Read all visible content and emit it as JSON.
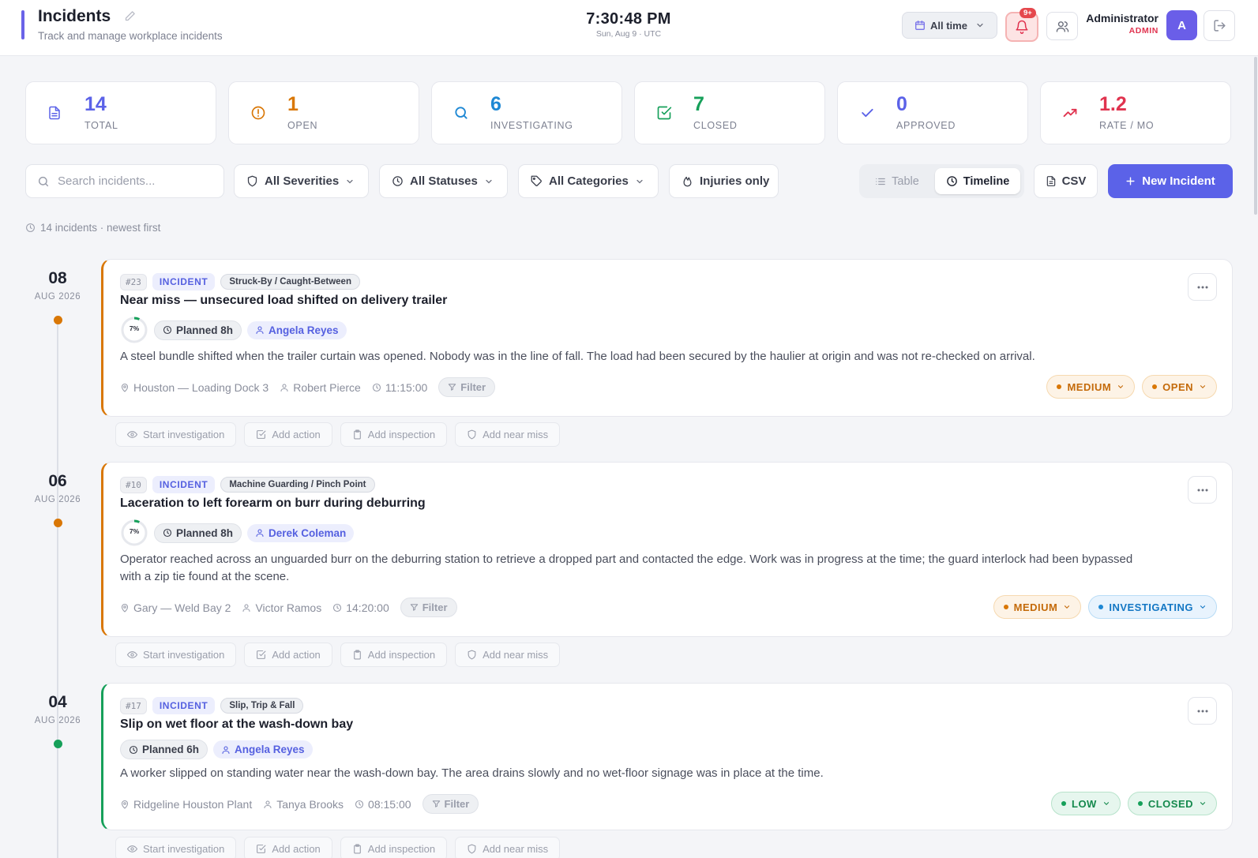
{
  "header": {
    "title": "Incidents",
    "subtitle": "Track and manage workplace incidents",
    "time": "7:30:48 PM",
    "date": "Sun, Aug 9 · UTC",
    "range_label": "All time",
    "notif_badge": "9+",
    "user_name": "Administrator",
    "user_role": "ADMIN",
    "avatar_letter": "A"
  },
  "stats": [
    {
      "value": "14",
      "label": "TOTAL",
      "color": "#5b62e8",
      "icon": "document-icon"
    },
    {
      "value": "1",
      "label": "OPEN",
      "color": "#d97706",
      "icon": "alert-circle-icon"
    },
    {
      "value": "6",
      "label": "INVESTIGATING",
      "color": "#1e88d4",
      "icon": "search-icon"
    },
    {
      "value": "7",
      "label": "CLOSED",
      "color": "#16a05a",
      "icon": "check-square-icon"
    },
    {
      "value": "0",
      "label": "APPROVED",
      "color": "#5b62e8",
      "icon": "check-icon"
    },
    {
      "value": "1.2",
      "label": "RATE / MO",
      "color": "#e0334f",
      "icon": "trending-up-icon"
    }
  ],
  "toolbar": {
    "search_placeholder": "Search incidents...",
    "severity": "All Severities",
    "status": "All Statuses",
    "category": "All Categories",
    "injuries": "Injuries only",
    "view_table": "Table",
    "view_timeline": "Timeline",
    "csv": "CSV",
    "new_incident": "New Incident"
  },
  "list_summary": "14 incidents · newest first",
  "action_labels": {
    "investigate": "Start investigation",
    "action": "Add action",
    "inspection": "Add inspection",
    "near_miss": "Add near miss"
  },
  "filter_tag": "Filter",
  "incidents": [
    {
      "day": "08",
      "month": "AUG 2026",
      "id": "#23",
      "type": "INCIDENT",
      "category": "Struck-By / Caught-Between",
      "title": "Near miss — unsecured load shifted on delivery trailer",
      "progress": "7%",
      "planned": "Planned 8h",
      "assignee": "Angela Reyes",
      "description": "A steel bundle shifted when the trailer curtain was opened. Nobody was in the line of fall. The load had been secured by the haulier at origin and was not re-checked on arrival.",
      "location": "Houston — Loading Dock 3",
      "reporter": "Robert Pierce",
      "time": "11:15:00",
      "severity": "MEDIUM",
      "status": "OPEN",
      "accent": "#d97706"
    },
    {
      "day": "06",
      "month": "AUG 2026",
      "id": "#10",
      "type": "INCIDENT",
      "category": "Machine Guarding / Pinch Point",
      "title": "Laceration to left forearm on burr during deburring",
      "progress": "7%",
      "planned": "Planned 8h",
      "assignee": "Derek Coleman",
      "description": "Operator reached across an unguarded burr on the deburring station to retrieve a dropped part and contacted the edge. Work was in progress at the time; the guard interlock had been bypassed with a zip tie found at the scene.",
      "location": "Gary — Weld Bay 2",
      "reporter": "Victor Ramos",
      "time": "14:20:00",
      "severity": "MEDIUM",
      "status": "INVESTIGATING",
      "accent": "#d97706"
    },
    {
      "day": "04",
      "month": "AUG 2026",
      "id": "#17",
      "type": "INCIDENT",
      "category": "Slip, Trip & Fall",
      "title": "Slip on wet floor at the wash-down bay",
      "planned": "Planned 6h",
      "assignee": "Angela Reyes",
      "description": "A worker slipped on standing water near the wash-down bay. The area drains slowly and no wet-floor signage was in place at the time.",
      "location": "Ridgeline Houston Plant",
      "reporter": "Tanya Brooks",
      "time": "08:15:00",
      "severity": "LOW",
      "status": "CLOSED",
      "accent": "#16a05a"
    }
  ]
}
